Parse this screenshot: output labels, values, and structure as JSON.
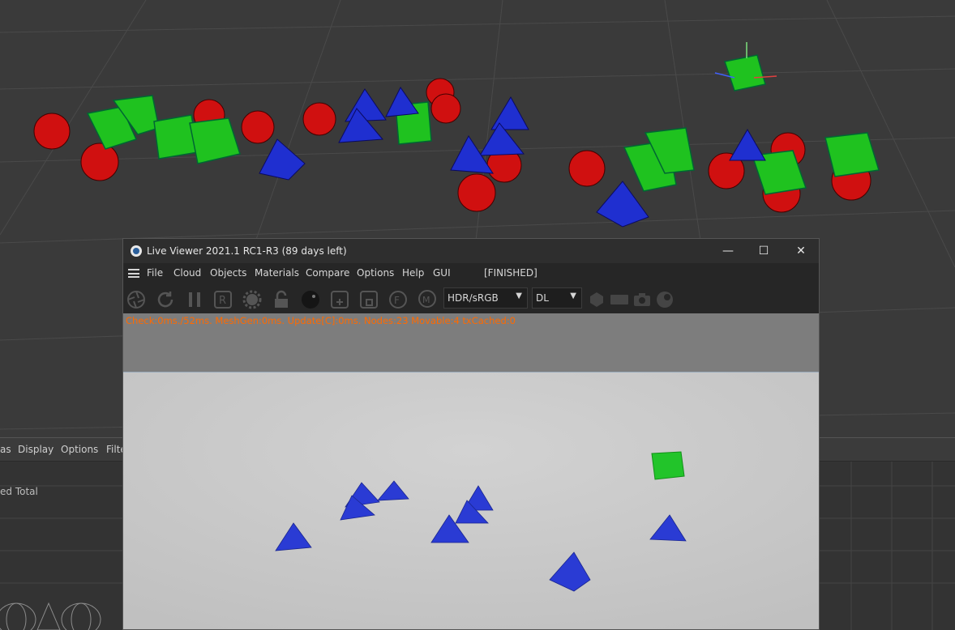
{
  "bottom_panel": {
    "menu": {
      "left_cut": "as",
      "display": "Display",
      "options": "Options",
      "filter_cut": "Filte"
    },
    "total_label": "ed Total"
  },
  "live_viewer": {
    "title": "Live Viewer 2021.1 RC1-R3 (89 days left)",
    "window_buttons": {
      "minimize": "—",
      "maximize": "☐",
      "close": "✕"
    },
    "menu": [
      "File",
      "Cloud",
      "Objects",
      "Materials",
      "Compare",
      "Options",
      "Help",
      "GUI"
    ],
    "status": "[FINISHED]",
    "toolbar": {
      "color_space": "HDR/sRGB",
      "render_kernel": "DL",
      "icons": [
        "aperture-icon",
        "refresh-icon",
        "pause-icon",
        "render-region-icon",
        "gear-icon",
        "lock-icon",
        "material-ball-icon",
        "add-box-icon",
        "square-box-icon",
        "focus-icon",
        "material-m-icon",
        "hexagon-icon",
        "film-icon",
        "camera-icon",
        "sphere-icon"
      ]
    },
    "stats_text": "Check:0ms./52ms. MeshGen:0ms. Update[C]:0ms. Nodes:23 Movable:4 txCached:0"
  },
  "colors": {
    "orange_stats": "#ff6a00",
    "cube_green": "#1fc21f",
    "sphere_red": "#d01010",
    "pyramid_blue": "#1f2fd0"
  }
}
